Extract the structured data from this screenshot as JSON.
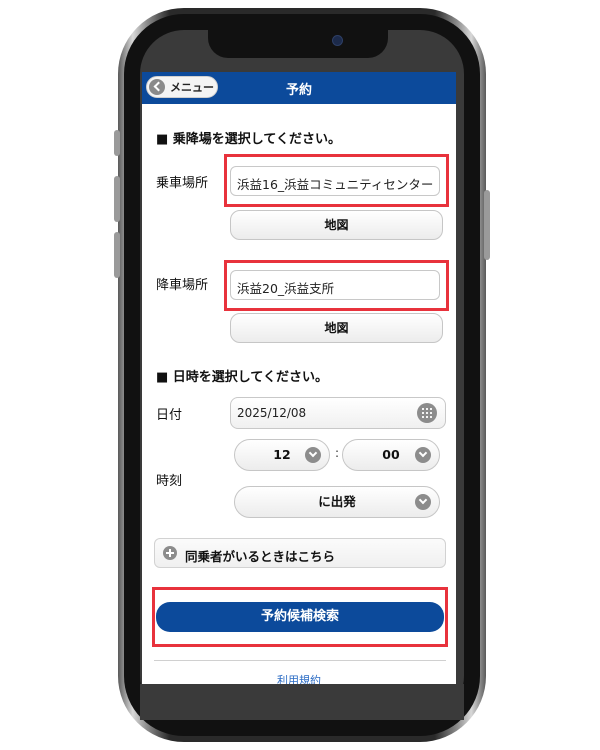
{
  "header": {
    "menu_label": "メニュー",
    "title": "予約"
  },
  "stops_section": {
    "heading": "■ 乗降場を選択してください。",
    "boarding_label": "乗車場所",
    "boarding_value": "浜益16_浜益コミュニティセンター",
    "map_button_1": "地図",
    "alighting_label": "降車場所",
    "alighting_value": "浜益20_浜益支所",
    "map_button_2": "地図"
  },
  "datetime_section": {
    "heading": "■ 日時を選択してください。",
    "date_label": "日付",
    "date_value": "2025/12/08",
    "time_label": "時刻",
    "hour_value": "12",
    "separator": ":",
    "minute_value": "00",
    "mode_value": "に出発"
  },
  "companion_label": "同乗者がいるときはこちら",
  "search_button": "予約候補検索",
  "footer_link": "利用規約",
  "colors": {
    "navbar": "#0c4a9b",
    "highlight": "#e8323c",
    "primary_button": "#0c4a9b"
  }
}
